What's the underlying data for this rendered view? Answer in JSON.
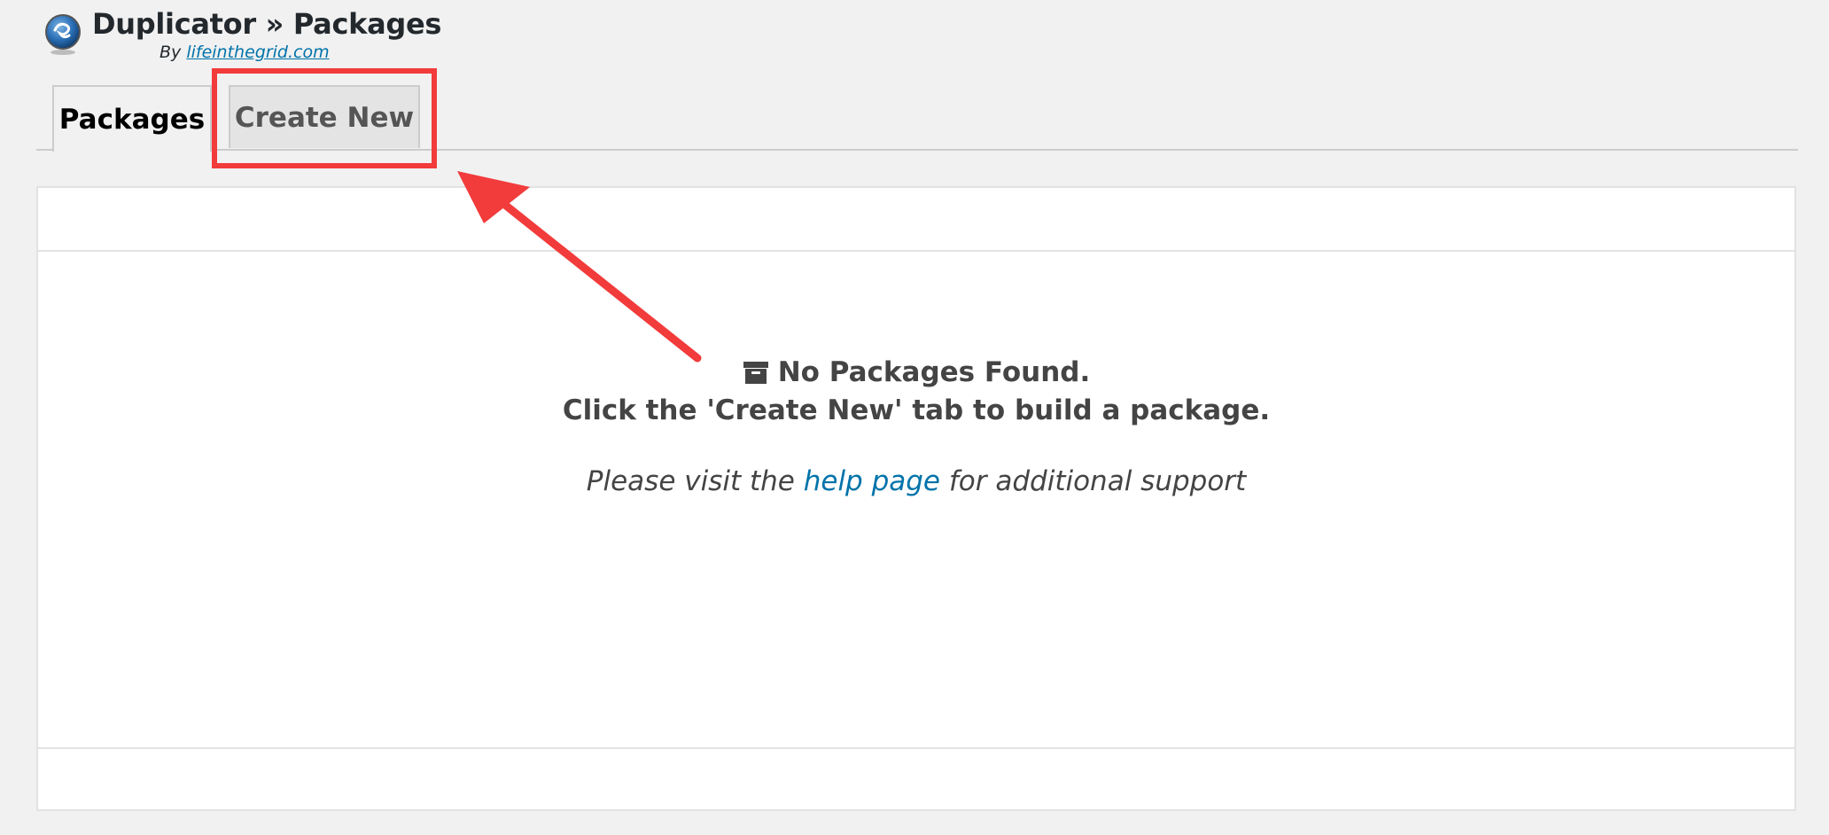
{
  "header": {
    "title": "Duplicator » Packages",
    "by_prefix": "By",
    "by_link": "lifeinthegrid.com"
  },
  "tabs": [
    {
      "label": "Packages",
      "active": true
    },
    {
      "label": "Create New",
      "active": false
    }
  ],
  "panel": {
    "empty_title": "No Packages Found.",
    "empty_sub": "Click the 'Create New' tab to build a package.",
    "help_prefix": "Please visit the",
    "help_link": "help page",
    "help_suffix": "for additional support"
  },
  "icons": {
    "logo": "duplicator-logo-icon",
    "empty": "archive-box-icon"
  },
  "colors": {
    "annotation_red": "#f23b3b",
    "link_blue": "#0073aa"
  }
}
